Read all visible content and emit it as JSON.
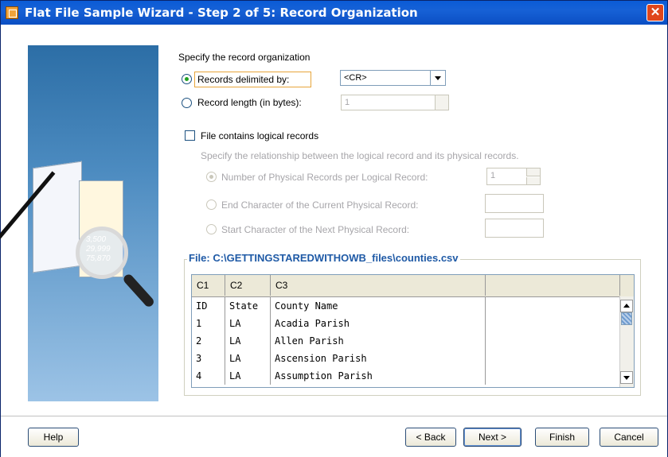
{
  "window": {
    "title": "Flat File Sample Wizard - Step 2 of 5: Record Organization",
    "close_glyph": "✕"
  },
  "form": {
    "heading": "Specify the record organization",
    "delimited_label": "Records delimited by:",
    "delimiter_value": "<CR>",
    "record_length_label": "Record length (in bytes):",
    "record_length_value": "1",
    "logical_records_label": "File contains logical records",
    "relationship_text": "Specify the relationship between the logical record and its physical records.",
    "option_physical": "Number of Physical Records per Logical Record:",
    "physical_value": "1",
    "option_end_char": "End Character of the Current Physical Record:",
    "option_start_char": "Start Character of the Next Physical Record:"
  },
  "file_panel": {
    "title": "File: C:\\GETTINGSTAREDWITHOWB_files\\counties.csv",
    "columns": [
      "C1",
      "C2",
      "C3"
    ],
    "rows": [
      [
        "ID",
        "State",
        "County Name"
      ],
      [
        "1",
        "LA",
        "Acadia Parish"
      ],
      [
        "2",
        "LA",
        "Allen Parish"
      ],
      [
        "3",
        "LA",
        "Ascension Parish"
      ],
      [
        "4",
        "LA",
        "Assumption Parish"
      ]
    ]
  },
  "buttons": {
    "help": "Help",
    "back": "< Back",
    "next": "Next >",
    "finish": "Finish",
    "cancel": "Cancel"
  },
  "art_numbers": [
    "3,500",
    "29,999",
    "75,870"
  ],
  "colors": {
    "title_bar": "#0a5bd6",
    "focus_border": "#e7a53b",
    "file_title": "#1f5aa6",
    "radio_selected": "#21a121"
  }
}
